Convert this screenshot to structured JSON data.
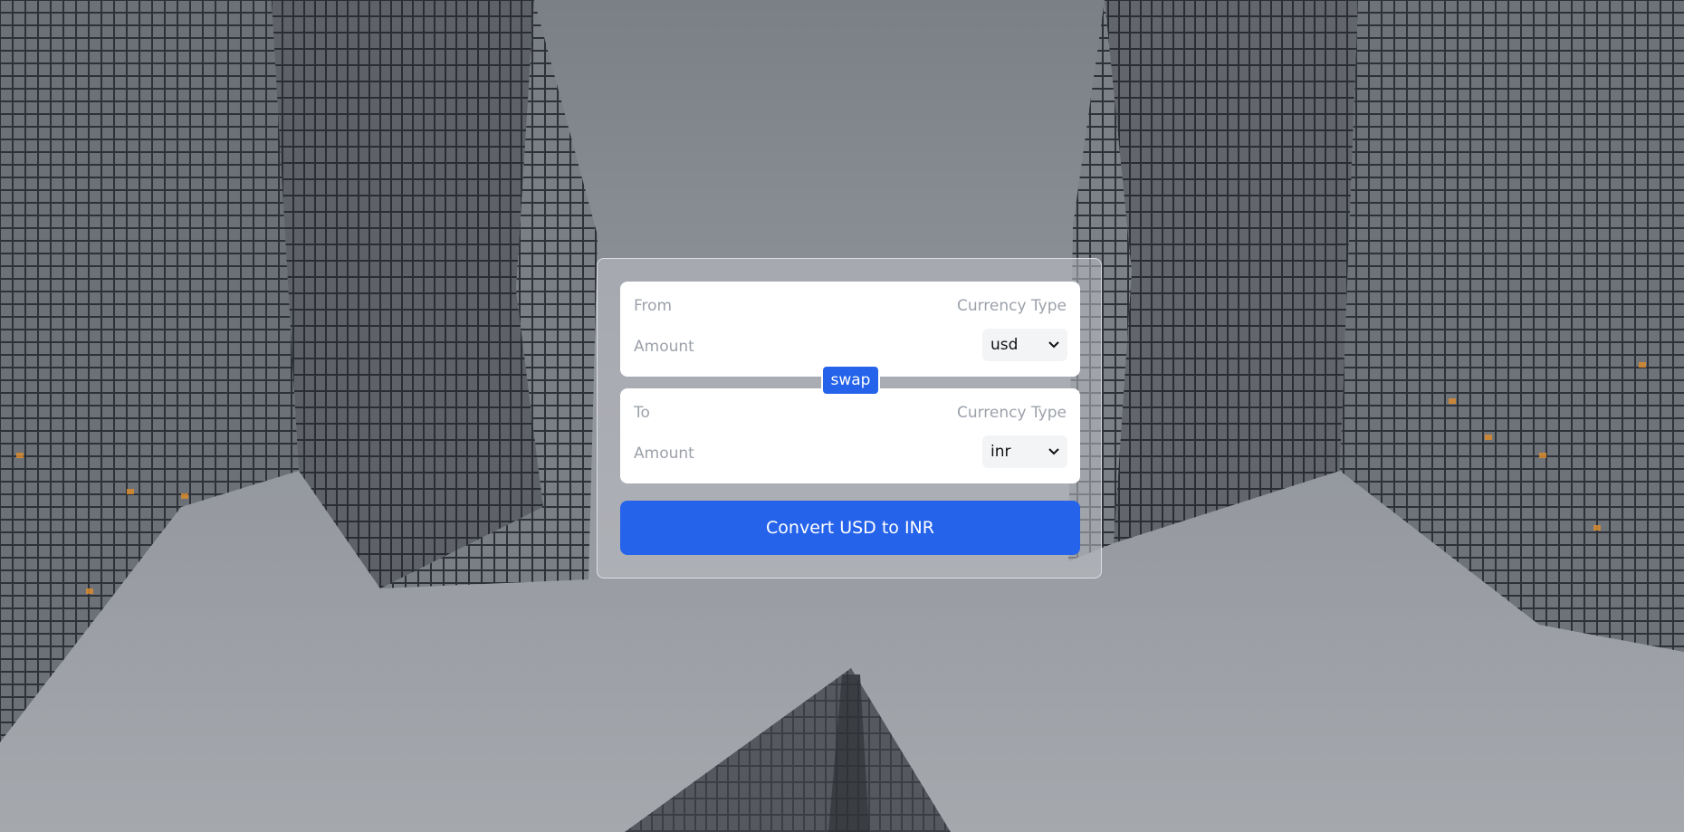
{
  "from_panel": {
    "label": "From",
    "currency_type_label": "Currency Type",
    "amount_placeholder": "Amount",
    "currency": "usd"
  },
  "swap": {
    "label": "swap"
  },
  "to_panel": {
    "label": "To",
    "currency_type_label": "Currency Type",
    "amount_placeholder": "Amount",
    "currency": "inr"
  },
  "convert": {
    "label": "Convert USD to INR"
  },
  "colors": {
    "accent": "#2563eb",
    "panel_bg": "#ffffff",
    "muted_text": "#9ca1aa"
  }
}
